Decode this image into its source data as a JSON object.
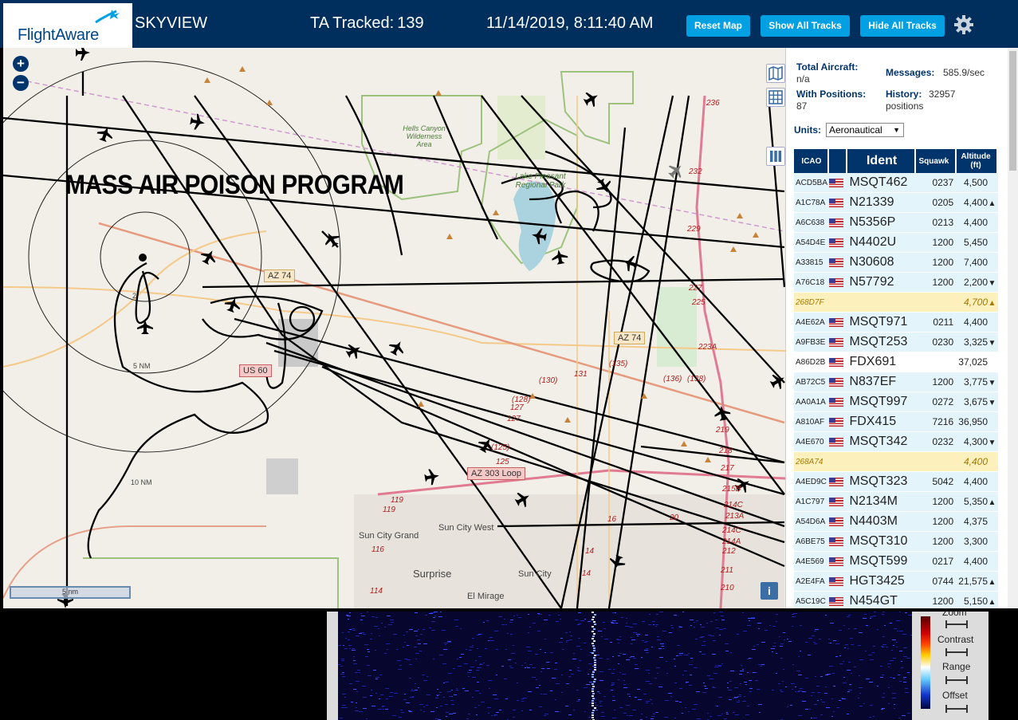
{
  "header": {
    "logo_text": "FlightAware",
    "title": "SKYVIEW",
    "tracked_label": "TA Tracked:",
    "tracked_count": "139",
    "datetime": "11/14/2019, 8:11:40 AM",
    "buttons": {
      "reset": "Reset Map",
      "show_all": "Show All Tracks",
      "hide_all": "Hide All Tracks"
    }
  },
  "map": {
    "zoom_in": "+",
    "zoom_out": "−",
    "watermark": "MASS AIR POISON PROGRAM",
    "park_label": "Lake Pleasant Regional Park",
    "wilderness_label": "Hells Canyon Wilderness Area",
    "range_rings": [
      "5 NM",
      "10 NM"
    ],
    "ring_tick": "2",
    "highway_shields": [
      "AZ 74",
      "AZ 74",
      "US 60",
      "AZ 303 Loop"
    ],
    "route_numbers": [
      "236",
      "232",
      "229",
      "227",
      "225",
      "223A",
      "(138)",
      "(136)",
      "(135)",
      "(130)",
      "131",
      "(128)",
      "127",
      "127",
      "(125)",
      "125",
      "119",
      "119",
      "116",
      "114",
      "14",
      "14",
      "16",
      "219",
      "218",
      "217",
      "215B",
      "214C",
      "213A",
      "214C",
      "214A",
      "212",
      "211",
      "210",
      "20"
    ],
    "towns": [
      "Sun City Grand",
      "Sun City West",
      "Surprise",
      "Sun City",
      "El Mirage"
    ],
    "scale": "5 nm",
    "info": "i"
  },
  "panel": {
    "total_aircraft_label": "Total Aircraft:",
    "total_aircraft_value": "n/a",
    "messages_label": "Messages:",
    "messages_value": "585.9/sec",
    "with_positions_label": "With Positions:",
    "with_positions_value": "87",
    "history_label": "History:",
    "history_value": "32957",
    "history_unit": "positions",
    "units_label": "Units:",
    "units_value": "Aeronautical",
    "columns": {
      "icao": "ICAO",
      "ident": "Ident",
      "squawk": "Squawk",
      "altitude": "Altitude (ft)"
    },
    "rows": [
      {
        "icao": "ACD5BA",
        "ident": "MSQT462",
        "squawk": "0237",
        "alt": "4,500",
        "trend": "",
        "flag": true
      },
      {
        "icao": "A1C78A",
        "ident": "N21339",
        "squawk": "0205",
        "alt": "4,400",
        "trend": "▲",
        "flag": true
      },
      {
        "icao": "A6C638",
        "ident": "N5356P",
        "squawk": "0213",
        "alt": "4,400",
        "trend": "",
        "flag": true
      },
      {
        "icao": "A54D4E",
        "ident": "N4402U",
        "squawk": "1200",
        "alt": "5,450",
        "trend": "",
        "flag": true
      },
      {
        "icao": "A33815",
        "ident": "N30608",
        "squawk": "1200",
        "alt": "7,400",
        "trend": "",
        "flag": true
      },
      {
        "icao": "A76C18",
        "ident": "N57792",
        "squawk": "1200",
        "alt": "2,200",
        "trend": "▼",
        "flag": true
      },
      {
        "icao": "268D7F",
        "ident": "",
        "squawk": "",
        "alt": "4,700",
        "trend": "▲",
        "flag": false,
        "nopos": true
      },
      {
        "icao": "A4E62A",
        "ident": "MSQT971",
        "squawk": "0211",
        "alt": "4,400",
        "trend": "",
        "flag": true
      },
      {
        "icao": "A9FB3E",
        "ident": "MSQT253",
        "squawk": "0230",
        "alt": "3,325",
        "trend": "▼",
        "flag": true
      },
      {
        "icao": "A86D2B",
        "ident": "FDX691",
        "squawk": "",
        "alt": "37,025",
        "trend": "",
        "flag": true
      },
      {
        "icao": "AB72C5",
        "ident": "N837EF",
        "squawk": "1200",
        "alt": "3,775",
        "trend": "▼",
        "flag": true
      },
      {
        "icao": "AA0A1A",
        "ident": "MSQT997",
        "squawk": "0272",
        "alt": "3,675",
        "trend": "▼",
        "flag": true
      },
      {
        "icao": "A810AF",
        "ident": "FDX415",
        "squawk": "7216",
        "alt": "36,950",
        "trend": "",
        "flag": true
      },
      {
        "icao": "A4E670",
        "ident": "MSQT342",
        "squawk": "0232",
        "alt": "4,300",
        "trend": "▼",
        "flag": true
      },
      {
        "icao": "268A74",
        "ident": "",
        "squawk": "",
        "alt": "4,400",
        "trend": "",
        "flag": false,
        "nopos": true
      },
      {
        "icao": "A4ED9C",
        "ident": "MSQT323",
        "squawk": "5042",
        "alt": "4,400",
        "trend": "",
        "flag": true
      },
      {
        "icao": "A1C797",
        "ident": "N2134M",
        "squawk": "1200",
        "alt": "5,350",
        "trend": "▲",
        "flag": true
      },
      {
        "icao": "A54D6A",
        "ident": "N4403M",
        "squawk": "1200",
        "alt": "4,375",
        "trend": "",
        "flag": true
      },
      {
        "icao": "A6BE75",
        "ident": "MSQT310",
        "squawk": "1200",
        "alt": "3,300",
        "trend": "",
        "flag": true
      },
      {
        "icao": "A4E569",
        "ident": "MSQT599",
        "squawk": "0217",
        "alt": "4,400",
        "trend": "",
        "flag": true
      },
      {
        "icao": "A2E4FA",
        "ident": "HGT3425",
        "squawk": "0744",
        "alt": "21,575",
        "trend": "▲",
        "flag": true
      },
      {
        "icao": "A5C19C",
        "ident": "N454GT",
        "squawk": "1200",
        "alt": "5,150",
        "trend": "▲",
        "flag": true
      }
    ]
  },
  "waterfall": {
    "controls": [
      "Zoom",
      "Contrast",
      "Range",
      "Offset"
    ]
  },
  "colors": {
    "header": "#002f5d",
    "button": "#00a0e2",
    "table_head": "#00346b",
    "row_highlight": "#e4f4fb",
    "row_nopos": "#fcf1bd"
  }
}
